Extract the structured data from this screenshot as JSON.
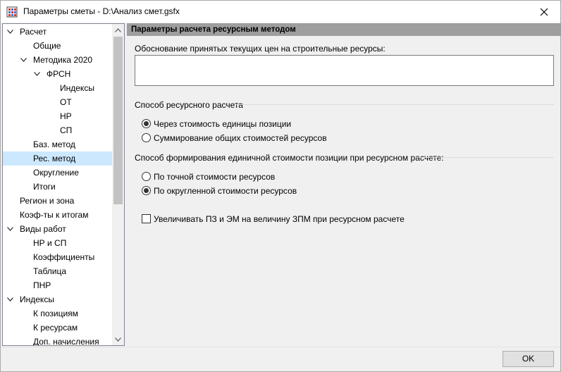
{
  "window": {
    "title": "Параметры сметы - D:\\Анализ смет.gsfx",
    "close_icon": "close-icon"
  },
  "tree": {
    "items": [
      {
        "label": "Расчет",
        "expanded": true
      },
      {
        "label": "Общие"
      },
      {
        "label": "Методика 2020",
        "expanded": true
      },
      {
        "label": "ФРСН",
        "expanded": true
      },
      {
        "label": "Индексы"
      },
      {
        "label": "ОТ"
      },
      {
        "label": "НР"
      },
      {
        "label": "СП"
      },
      {
        "label": "Баз. метод"
      },
      {
        "label": "Рес. метод",
        "selected": true
      },
      {
        "label": "Округление"
      },
      {
        "label": "Итоги"
      },
      {
        "label": "Регион и зона"
      },
      {
        "label": "Коэф-ты к итогам"
      },
      {
        "label": "Виды работ",
        "expanded": true
      },
      {
        "label": "НР и СП"
      },
      {
        "label": "Коэффициенты"
      },
      {
        "label": "Таблица"
      },
      {
        "label": "ПНР"
      },
      {
        "label": "Индексы",
        "expanded": true
      },
      {
        "label": "К позициям"
      },
      {
        "label": "К ресурсам"
      },
      {
        "label": "Доп. начисления"
      }
    ]
  },
  "panel": {
    "header": "Параметры расчета ресурсным методом",
    "justification_label": "Обоснование принятых текущих цен на строительные ресурсы:",
    "justification_value": "",
    "calc_method_label": "Способ ресурсного расчета",
    "calc_options": [
      {
        "label": "Через стоимость единицы позиции",
        "checked": true
      },
      {
        "label": "Суммирование общих стоимостей ресурсов",
        "checked": false
      }
    ],
    "unit_cost_label": "Способ формирования единичной стоимости позиции при ресурсном расчете:",
    "unit_cost_options": [
      {
        "label": "По точной стоимости ресурсов",
        "checked": false
      },
      {
        "label": "По округленной стоимости ресурсов",
        "checked": true
      }
    ],
    "increase_checkbox_label": "Увеличивать ПЗ и ЭМ на величину ЗПМ при ресурсном расчете",
    "increase_checked": false
  },
  "footer": {
    "ok_label": "OK"
  }
}
